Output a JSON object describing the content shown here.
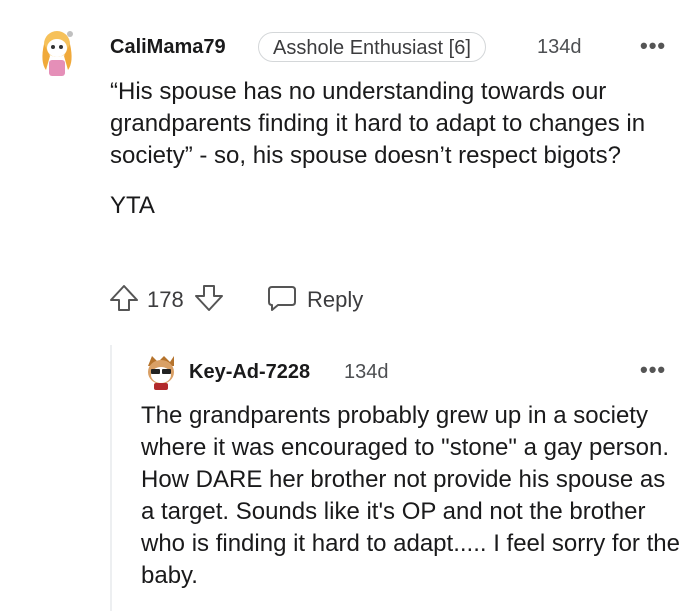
{
  "comment": {
    "username": "CaliMama79",
    "flair": "Asshole Enthusiast [6]",
    "age": "134d",
    "more": "•••",
    "body_lines": [
      "“His spouse has no understanding towards our grandparents finding it hard to adapt to changes in society” - so, his spouse doesn’t respect bigots?",
      "YTA"
    ],
    "votes": "178",
    "reply_label": "Reply"
  },
  "reply": {
    "username": "Key-Ad-7228",
    "age": "134d",
    "more": "•••",
    "body": "The grandparents probably grew up in a society where it was encouraged to \"stone\" a gay person. How DARE her brother not provide his spouse as a target. Sounds like it's OP and not the brother who is finding it hard to adapt..... I feel sorry for the baby."
  },
  "colors": {
    "text": "#1a1a1b",
    "muted": "#4d4f52",
    "border": "#d4d7d9",
    "thread_line": "#edeff1"
  },
  "icons": [
    "snoo-avatar-icon",
    "upvote-arrow-icon",
    "downvote-arrow-icon",
    "reply-bubble-icon",
    "more-options-icon"
  ]
}
